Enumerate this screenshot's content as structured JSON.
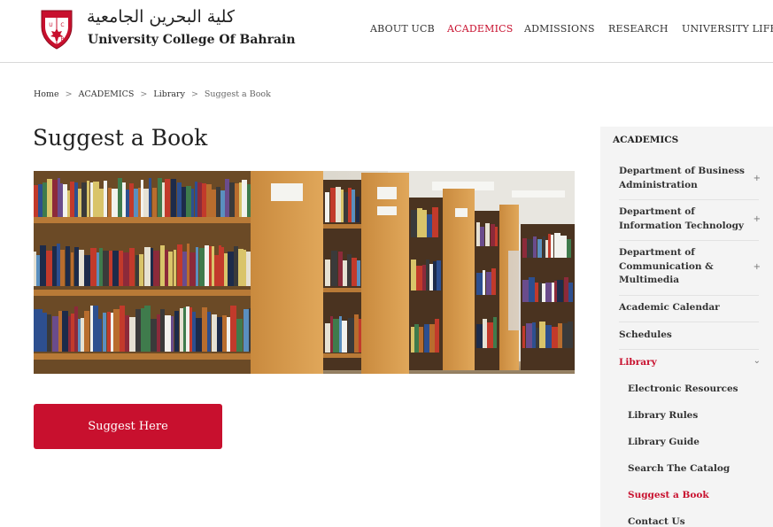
{
  "brand": {
    "arabic_name": "كلية البحرين الجامعية",
    "english_name": "University College Of Bahrain",
    "logo_icon": "ucb-shield-logo",
    "logo_letters": [
      "U",
      "C",
      "B"
    ]
  },
  "nav": {
    "items": [
      {
        "label": "ABOUT UCB"
      },
      {
        "label": "ACADEMICS"
      },
      {
        "label": "ADMISSIONS"
      },
      {
        "label": "RESEARCH"
      },
      {
        "label": "UNIVERSITY LIFE"
      }
    ],
    "active": "ACADEMICS"
  },
  "breadcrumb": {
    "items": [
      "Home",
      "ACADEMICS",
      "Library",
      "Suggest a Book"
    ],
    "separator": ">"
  },
  "page": {
    "title": "Suggest a Book",
    "hero_alt": "library-bookshelves-photo",
    "button_label": "Suggest Here"
  },
  "sidebar": {
    "heading": "ACADEMICS",
    "items": [
      {
        "label": "Department of Business Administration",
        "toggle": "+"
      },
      {
        "label": "Department of Information Technology",
        "toggle": "+"
      },
      {
        "label": "Department of Communication & Multimedia",
        "toggle": "+"
      },
      {
        "label": "Academic Calendar"
      },
      {
        "label": "Schedules"
      },
      {
        "label": "Library",
        "toggle": "⌄"
      }
    ],
    "library_sub": [
      "Electronic Resources",
      "Library Rules",
      "Library Guide",
      "Search The Catalog",
      "Suggest a Book",
      "Contact Us"
    ]
  },
  "colors": {
    "accent": "#c8102e",
    "sidebar_bg": "#f4f4f4",
    "text": "#222222"
  }
}
